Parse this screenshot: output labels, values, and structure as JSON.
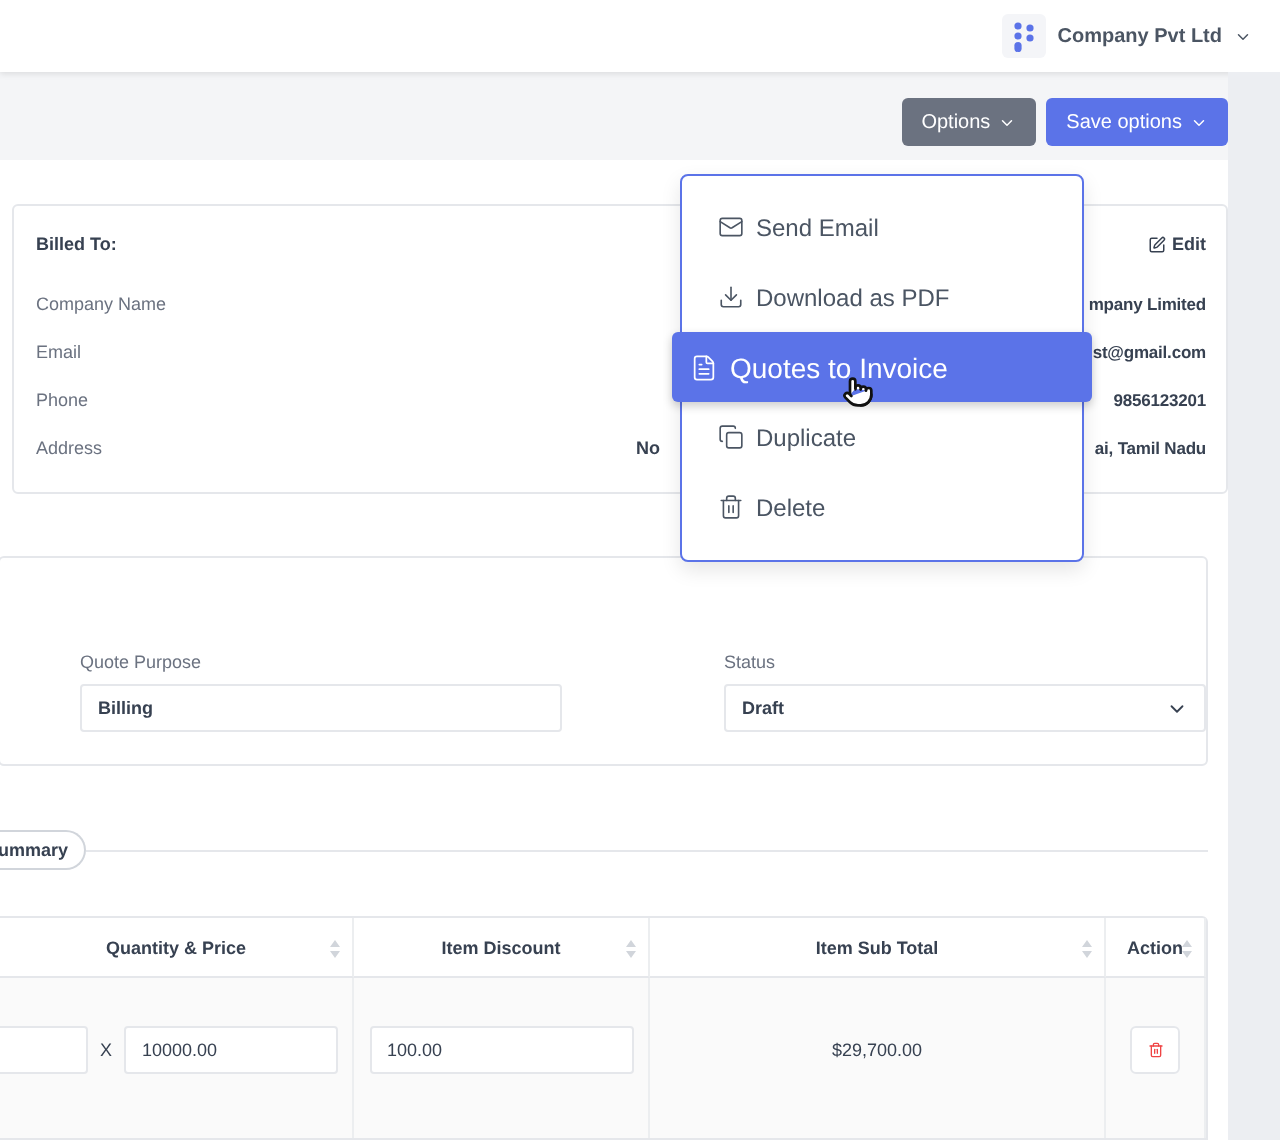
{
  "header": {
    "company": "Company Pvt Ltd"
  },
  "toolbar": {
    "buttons": [
      {
        "label": "Options",
        "kind": "secondary"
      },
      {
        "label": "Save options",
        "kind": "primary"
      }
    ]
  },
  "billed_to": {
    "title": "Billed To:",
    "edit": "Edit",
    "rows": [
      {
        "label": "Company Name",
        "value": "mpany Limited"
      },
      {
        "label": "Email",
        "value": "st@gmail.com"
      },
      {
        "label": "Phone",
        "value": "9856123201"
      },
      {
        "label": "Address",
        "value_start": "No",
        "value": "ai, Tamil Nadu"
      }
    ]
  },
  "menu": {
    "items": [
      {
        "label": "Send Email",
        "selected": false
      },
      {
        "label": "Download as PDF",
        "selected": false
      },
      {
        "label": "Quotes to Invoice",
        "selected": true
      },
      {
        "label": "Duplicate",
        "selected": false
      },
      {
        "label": "Delete",
        "selected": false
      }
    ]
  },
  "details": {
    "fields": [
      {
        "label": "Quote Purpose",
        "value": "Billing",
        "kind": "text"
      },
      {
        "label": "Status",
        "value": "Draft",
        "kind": "select"
      }
    ]
  },
  "section_tab": "ummary",
  "table": {
    "columns": [
      "Quantity & Price",
      "Item Discount",
      "Item Sub Total",
      "Action"
    ],
    "rows": [
      {
        "times": "X",
        "price": "10000.00",
        "discount": "100.00",
        "sub_total": "$29,700.00"
      }
    ]
  }
}
